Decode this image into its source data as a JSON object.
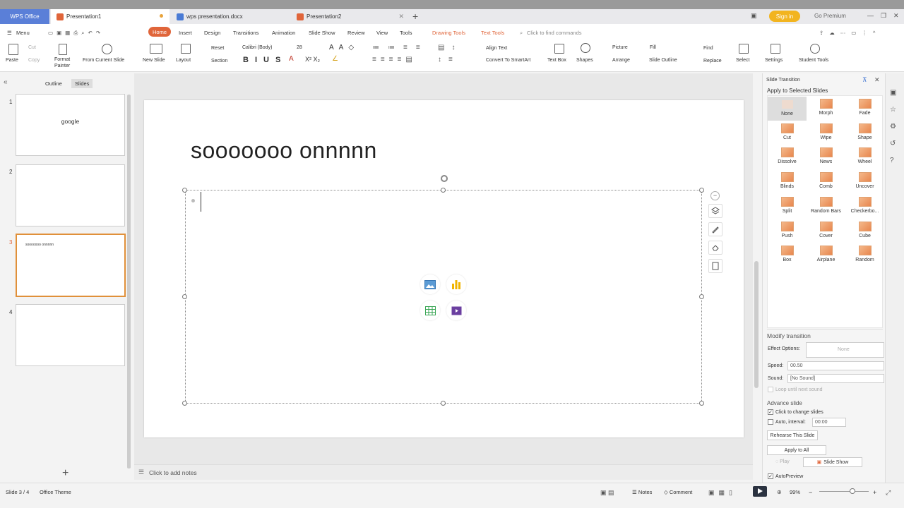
{
  "tabs": {
    "wps": "WPS Office",
    "t1": "Presentation1",
    "t2": "wps presentation.docx",
    "t3": "Presentation2"
  },
  "titlebar": {
    "signin": "Sign in",
    "premium": "Go Premium"
  },
  "menu": {
    "menu": "Menu",
    "home": "Home",
    "items": [
      "Insert",
      "Design",
      "Transitions",
      "Animation",
      "Slide Show",
      "Review",
      "View",
      "Tools"
    ],
    "drawing_tools": "Drawing Tools",
    "text_tools": "Text Tools",
    "search_placeholder": "Click to find commands"
  },
  "ribbon": {
    "paste": "Paste",
    "cut": "Cut",
    "copy": "Copy",
    "format_painter_1": "Format",
    "format_painter_2": "Painter",
    "from_current": "From Current Slide",
    "new_slide": "New Slide",
    "layout": "Layout",
    "reset": "Reset",
    "section": "Section",
    "font": "Calibri (Body)",
    "size": "28",
    "align_text": "Align Text",
    "convert": "Convert To SmartArt",
    "text_box": "Text Box",
    "shapes": "Shapes",
    "picture": "Picture",
    "arrange": "Arrange",
    "fill": "Fill",
    "slide_outline": "Slide Outline",
    "find": "Find",
    "replace": "Replace",
    "select": "Select",
    "settings": "Settings",
    "student_tools": "Student Tools"
  },
  "leftpane": {
    "outline": "Outline",
    "slides": "Slides",
    "thumbs": [
      {
        "num": "1",
        "text": "google"
      },
      {
        "num": "2",
        "text": ""
      },
      {
        "num": "3",
        "text": "sooooooo onnnnn"
      },
      {
        "num": "4",
        "text": ""
      }
    ]
  },
  "slide": {
    "title": "sooooooo onnnnn"
  },
  "notes": "Click to add notes",
  "transition_pane": {
    "header": "Slide Transition",
    "apply_selected": "Apply to Selected Slides",
    "items": [
      "None",
      "Morph",
      "Fade",
      "Cut",
      "Wipe",
      "Shape",
      "Dissolve",
      "News",
      "Wheel",
      "Blinds",
      "Comb",
      "Uncover",
      "Split",
      "Random Bars",
      "Checkerbo...",
      "Push",
      "Cover",
      "Cube",
      "Box",
      "Airplane",
      "Random"
    ],
    "selected": "None",
    "modify": "Modify transition",
    "effect_options_label": "Effect Options:",
    "effect_options_value": "None",
    "speed_label": "Speed:",
    "speed_value": "00.50",
    "sound_label": "Sound:",
    "sound_value": "[No Sound]",
    "loop": "Loop until next sound",
    "advance": "Advance slide",
    "click_change": "Click to change slides",
    "auto_interval": "Auto, interval:",
    "interval_value": "00:00",
    "rehearse": "Rehearse This Slide",
    "apply_all": "Apply to All",
    "play": "Play",
    "slide_show": "Slide Show",
    "autopreview": "AutoPreview"
  },
  "status": {
    "slide": "Slide 3 / 4",
    "theme": "Office Theme",
    "notes": "Notes",
    "comment": "Comment",
    "zoom": "99%"
  },
  "colors": {
    "accent": "#e0653a",
    "wps_blue": "#5a7fd8",
    "signin": "#f2b41f"
  }
}
